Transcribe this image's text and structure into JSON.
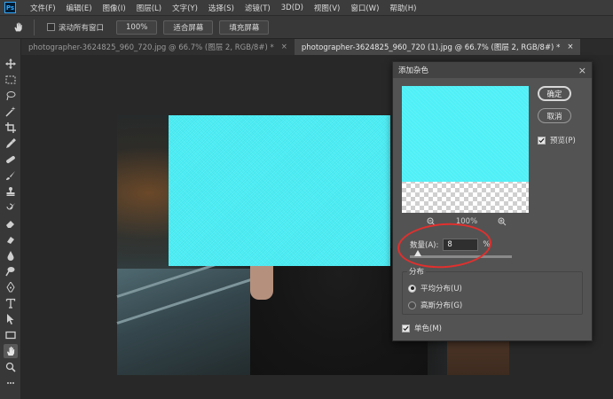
{
  "app": {
    "logo": "Ps"
  },
  "menu": [
    "文件(F)",
    "编辑(E)",
    "图像(I)",
    "图层(L)",
    "文字(Y)",
    "选择(S)",
    "滤镜(T)",
    "3D(D)",
    "视图(V)",
    "窗口(W)",
    "帮助(H)"
  ],
  "options": {
    "scroll_all_label": "滚动所有窗口",
    "zoom_btn": "100%",
    "fit_btn": "适合屏幕",
    "fill_btn": "填充屏幕"
  },
  "tabs": [
    {
      "label": "photographer-3624825_960_720.jpg @ 66.7% (图层 2, RGB/8#) *",
      "close": "×"
    },
    {
      "label": "photographer-3624825_960_720 (1).jpg @ 66.7% (图层 2, RGB/8#) *",
      "close": "×"
    }
  ],
  "tools": [
    "move-tool-icon",
    "marquee-tool-icon",
    "lasso-tool-icon",
    "magic-wand-icon",
    "crop-tool-icon",
    "eyedropper-icon",
    "healing-brush-icon",
    "brush-tool-icon",
    "clone-stamp-icon",
    "history-brush-icon",
    "eraser-tool-icon",
    "gradient-tool-icon",
    "blur-tool-icon",
    "dodge-tool-icon",
    "pen-tool-icon",
    "type-tool-icon",
    "path-select-icon",
    "rectangle-tool-icon",
    "hand-tool-icon",
    "zoom-tool-icon",
    "more-tools-icon"
  ],
  "dialog": {
    "title": "添加杂色",
    "close": "×",
    "ok": "确定",
    "cancel": "取消",
    "preview_label": "预览(P)",
    "zoom_value": "100%",
    "amount_label": "数量(A):",
    "amount_value": "8",
    "amount_unit": "%",
    "amount_fraction": 0.08,
    "distribution_label": "分布",
    "uniform_label": "平均分布(U)",
    "gaussian_label": "高斯分布(G)",
    "mono_label": "单色(M)",
    "noise_color": "#4ff0f7"
  },
  "annotation_color": "#e0302e"
}
